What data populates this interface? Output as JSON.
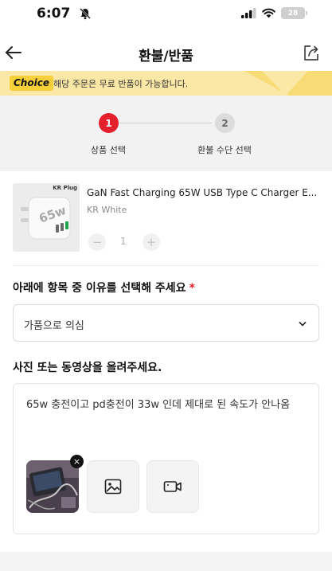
{
  "status_bar": {
    "time": "6:07",
    "battery": "28"
  },
  "nav": {
    "title": "환불/반품"
  },
  "banner": {
    "badge": "Choice",
    "text": "해당 주문은 무료 반품이 가능합니다.",
    "color": "#fbe7a6"
  },
  "steps": [
    {
      "number": "1",
      "label": "상품 선택",
      "active": true
    },
    {
      "number": "2",
      "label": "환불 수단 선택",
      "active": false
    }
  ],
  "product": {
    "thumb_label": "KR Plug",
    "title": "GaN Fast Charging 65W USB Type C Charger E...",
    "variant": "KR White",
    "quantity": "1",
    "minus": "−",
    "plus": "+"
  },
  "reason": {
    "heading": "아래에 항목 중 이유를 선택해 주세요",
    "required_mark": "*",
    "selected": "가품으로 의심"
  },
  "upload": {
    "heading": "사진 또는 동영상을 올려주세요.",
    "comment": "65w 충전이고 pd충전이 33w 인데 제대로 된 속도가 안나옴",
    "close": "×"
  },
  "colors": {
    "accent": "#e4202c",
    "step_bg": "#f2f2f2"
  }
}
